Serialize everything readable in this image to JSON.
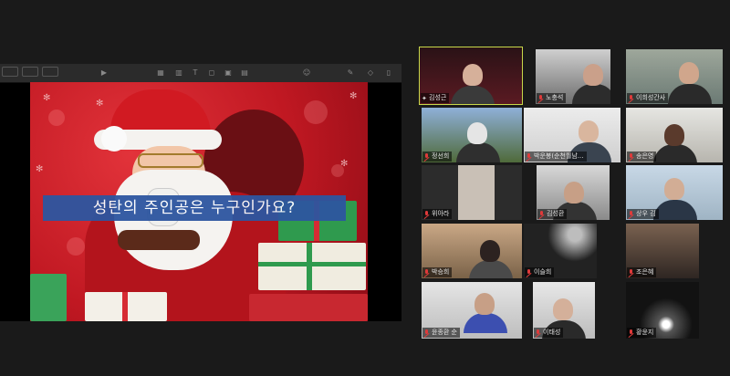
{
  "share": {
    "caption": "성탄의 주인공은 누구인가요?",
    "toolbar_icons": [
      "window-icon",
      "present-icon",
      "table-icon",
      "chart-icon",
      "text-icon",
      "shape-icon",
      "media-icon",
      "comment-icon",
      "collaborate-icon",
      "format-icon",
      "animate-icon",
      "document-icon"
    ]
  },
  "participants": [
    {
      "name": "김성근",
      "muted": false,
      "pinned": true,
      "active": true
    },
    {
      "name": "노충석",
      "muted": true
    },
    {
      "name": "이희성간사",
      "muted": true
    },
    {
      "name": "정선희",
      "muted": true
    },
    {
      "name": "박운봉(순천월남...",
      "muted": true
    },
    {
      "name": "송은영",
      "muted": true
    },
    {
      "name": "위아라",
      "muted": true
    },
    {
      "name": "김성환",
      "muted": true
    },
    {
      "name": "상우 김",
      "muted": true
    },
    {
      "name": "박승희",
      "muted": true
    },
    {
      "name": "이슬희",
      "muted": true
    },
    {
      "name": "조은혜",
      "muted": true
    },
    {
      "name": "윤종환 순",
      "muted": true
    },
    {
      "name": "이태성",
      "muted": true
    },
    {
      "name": "황윤지",
      "muted": true
    }
  ],
  "colors": {
    "background": "#1a1a1a",
    "active_outline": "#c8d84a",
    "muted_mic": "#e03a3a",
    "caption_bg": "#2d56a0"
  }
}
